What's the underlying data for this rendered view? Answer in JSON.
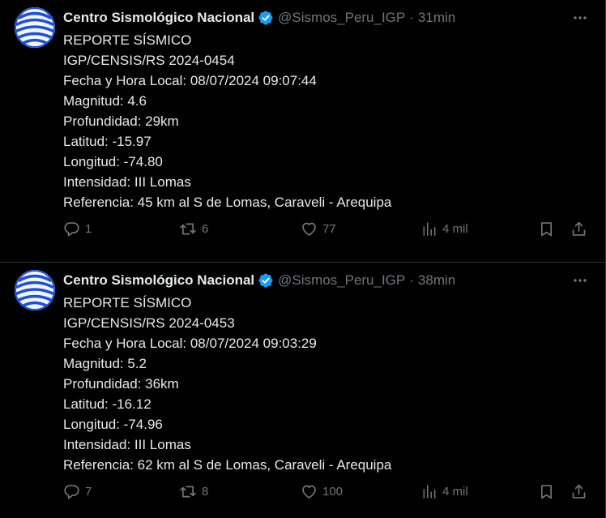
{
  "tweets": [
    {
      "name": "Centro Sismológico Nacional",
      "handle": "@Sismos_Peru_IGP",
      "separator": "·",
      "time": "31min",
      "lines": [
        "REPORTE SÍSMICO",
        "IGP/CENSIS/RS 2024-0454",
        "Fecha y Hora Local: 08/07/2024 09:07:44",
        "Magnitud: 4.6",
        "Profundidad: 29km",
        "Latitud: -15.97",
        "Longitud: -74.80",
        "Intensidad: III Lomas",
        "Referencia: 45 km al S de Lomas, Caraveli - Arequipa"
      ],
      "replies": "1",
      "retweets": "6",
      "likes": "77",
      "views": "4 mil"
    },
    {
      "name": "Centro Sismológico Nacional",
      "handle": "@Sismos_Peru_IGP",
      "separator": "·",
      "time": "38min",
      "lines": [
        "REPORTE SÍSMICO",
        "IGP/CENSIS/RS 2024-0453",
        "Fecha y Hora Local: 08/07/2024 09:03:29",
        "Magnitud: 5.2",
        "Profundidad: 36km",
        "Latitud: -16.12",
        "Longitud: -74.96",
        "Intensidad: III Lomas",
        "Referencia: 62 km al S de Lomas, Caraveli - Arequipa"
      ],
      "replies": "7",
      "retweets": "8",
      "likes": "100",
      "views": "4 mil"
    }
  ],
  "icons": {
    "verified": "verified-badge-icon",
    "more": "more-icon",
    "reply": "reply-icon",
    "retweet": "retweet-icon",
    "like": "like-icon",
    "views": "views-icon",
    "bookmark": "bookmark-icon",
    "share": "share-icon"
  },
  "colors": {
    "background": "#000000",
    "text": "#e7e9ea",
    "muted": "#71767b",
    "border": "#2f3336",
    "verified": "#1d9bf0",
    "avatar_blue": "#1f4fd6"
  }
}
